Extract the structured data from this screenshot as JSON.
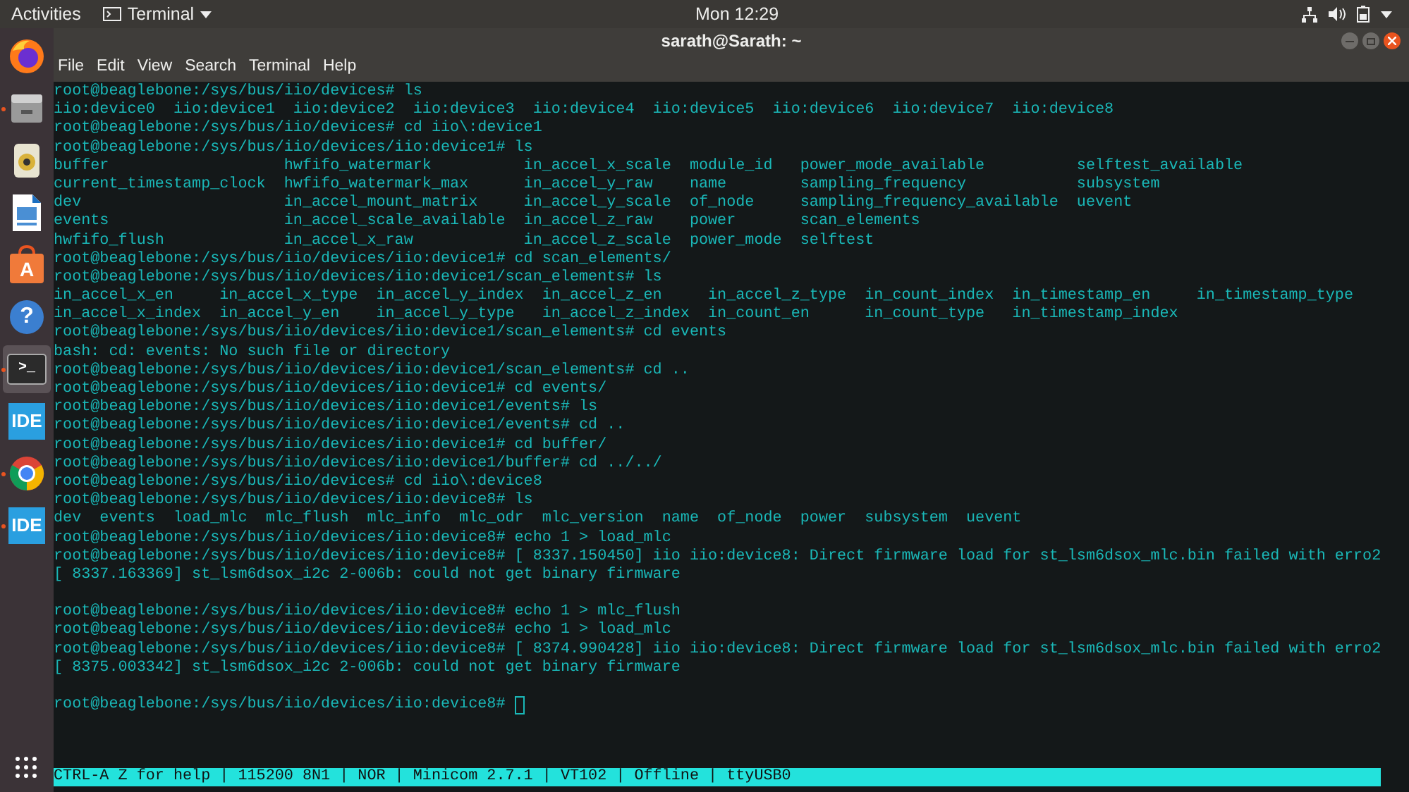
{
  "top_bar": {
    "activities": "Activities",
    "app_menu": "Terminal",
    "clock": "Mon 12:29"
  },
  "dock": [
    {
      "kind": "browser",
      "running": false,
      "selected": false
    },
    {
      "kind": "files",
      "running": true,
      "selected": false
    },
    {
      "kind": "speaker",
      "running": false,
      "selected": false
    },
    {
      "kind": "document",
      "running": false,
      "selected": false
    },
    {
      "kind": "store",
      "label": "A",
      "running": false,
      "selected": false
    },
    {
      "kind": "help",
      "label": "?",
      "running": false,
      "selected": false
    },
    {
      "kind": "terminal",
      "label": ">_",
      "running": true,
      "selected": true
    },
    {
      "kind": "ide",
      "label": "IDE",
      "running": false,
      "selected": false
    },
    {
      "kind": "web",
      "running": true,
      "selected": false
    },
    {
      "kind": "ide",
      "label": "IDE",
      "running": true,
      "selected": false
    }
  ],
  "window": {
    "title": "sarath@Sarath: ~"
  },
  "menu": [
    "File",
    "Edit",
    "View",
    "Search",
    "Terminal",
    "Help"
  ],
  "terminal_lines": [
    {
      "text": "root@beaglebone:/sys/bus/iio/devices# ls"
    },
    {
      "text": "iio:device0  iio:device1  iio:device2  iio:device3  iio:device4  iio:device5  iio:device6  iio:device7  iio:device8"
    },
    {
      "text": "root@beaglebone:/sys/bus/iio/devices# cd iio\\:device1"
    },
    {
      "text": "root@beaglebone:/sys/bus/iio/devices/iio:device1# ls"
    },
    {
      "text": "buffer                   hwfifo_watermark          in_accel_x_scale  module_id   power_mode_available          selftest_available"
    },
    {
      "text": "current_timestamp_clock  hwfifo_watermark_max      in_accel_y_raw    name        sampling_frequency            subsystem"
    },
    {
      "text": "dev                      in_accel_mount_matrix     in_accel_y_scale  of_node     sampling_frequency_available  uevent"
    },
    {
      "text": "events                   in_accel_scale_available  in_accel_z_raw    power       scan_elements"
    },
    {
      "text": "hwfifo_flush             in_accel_x_raw            in_accel_z_scale  power_mode  selftest"
    },
    {
      "text": "root@beaglebone:/sys/bus/iio/devices/iio:device1# cd scan_elements/"
    },
    {
      "text": "root@beaglebone:/sys/bus/iio/devices/iio:device1/scan_elements# ls"
    },
    {
      "text": "in_accel_x_en     in_accel_x_type  in_accel_y_index  in_accel_z_en     in_accel_z_type  in_count_index  in_timestamp_en     in_timestamp_type"
    },
    {
      "text": "in_accel_x_index  in_accel_y_en    in_accel_y_type   in_accel_z_index  in_count_en      in_count_type   in_timestamp_index"
    },
    {
      "text": "root@beaglebone:/sys/bus/iio/devices/iio:device1/scan_elements# cd events"
    },
    {
      "text": "bash: cd: events: No such file or directory"
    },
    {
      "text": "root@beaglebone:/sys/bus/iio/devices/iio:device1/scan_elements# cd .."
    },
    {
      "text": "root@beaglebone:/sys/bus/iio/devices/iio:device1# cd events/"
    },
    {
      "text": "root@beaglebone:/sys/bus/iio/devices/iio:device1/events# ls"
    },
    {
      "text": "root@beaglebone:/sys/bus/iio/devices/iio:device1/events# cd .."
    },
    {
      "text": "root@beaglebone:/sys/bus/iio/devices/iio:device1# cd buffer/"
    },
    {
      "text": "root@beaglebone:/sys/bus/iio/devices/iio:device1/buffer# cd ../../"
    },
    {
      "text": "root@beaglebone:/sys/bus/iio/devices# cd iio\\:device8"
    },
    {
      "text": "root@beaglebone:/sys/bus/iio/devices/iio:device8# ls"
    },
    {
      "text": "dev  events  load_mlc  mlc_flush  mlc_info  mlc_odr  mlc_version  name  of_node  power  subsystem  uevent"
    },
    {
      "text": "root@beaglebone:/sys/bus/iio/devices/iio:device8# echo 1 > load_mlc"
    },
    {
      "text": "root@beaglebone:/sys/bus/iio/devices/iio:device8# [ 8337.150450] iio iio:device8: Direct firmware load for st_lsm6dsox_mlc.bin failed with erro2"
    },
    {
      "text": "[ 8337.163369] st_lsm6dsox_i2c 2-006b: could not get binary firmware",
      "blank_after": true
    },
    {
      "text": "root@beaglebone:/sys/bus/iio/devices/iio:device8# echo 1 > mlc_flush"
    },
    {
      "text": "root@beaglebone:/sys/bus/iio/devices/iio:device8# echo 1 > load_mlc"
    },
    {
      "text": "root@beaglebone:/sys/bus/iio/devices/iio:device8# [ 8374.990428] iio iio:device8: Direct firmware load for st_lsm6dsox_mlc.bin failed with erro2"
    },
    {
      "text": "[ 8375.003342] st_lsm6dsox_i2c 2-006b: could not get binary firmware",
      "blank_after": true
    },
    {
      "text": "root@beaglebone:/sys/bus/iio/devices/iio:device8# ",
      "cursor": true
    }
  ],
  "status_bar": "CTRL-A Z for help | 115200 8N1 | NOR | Minicom 2.7.1 | VT102 | Offline | ttyUSB0"
}
